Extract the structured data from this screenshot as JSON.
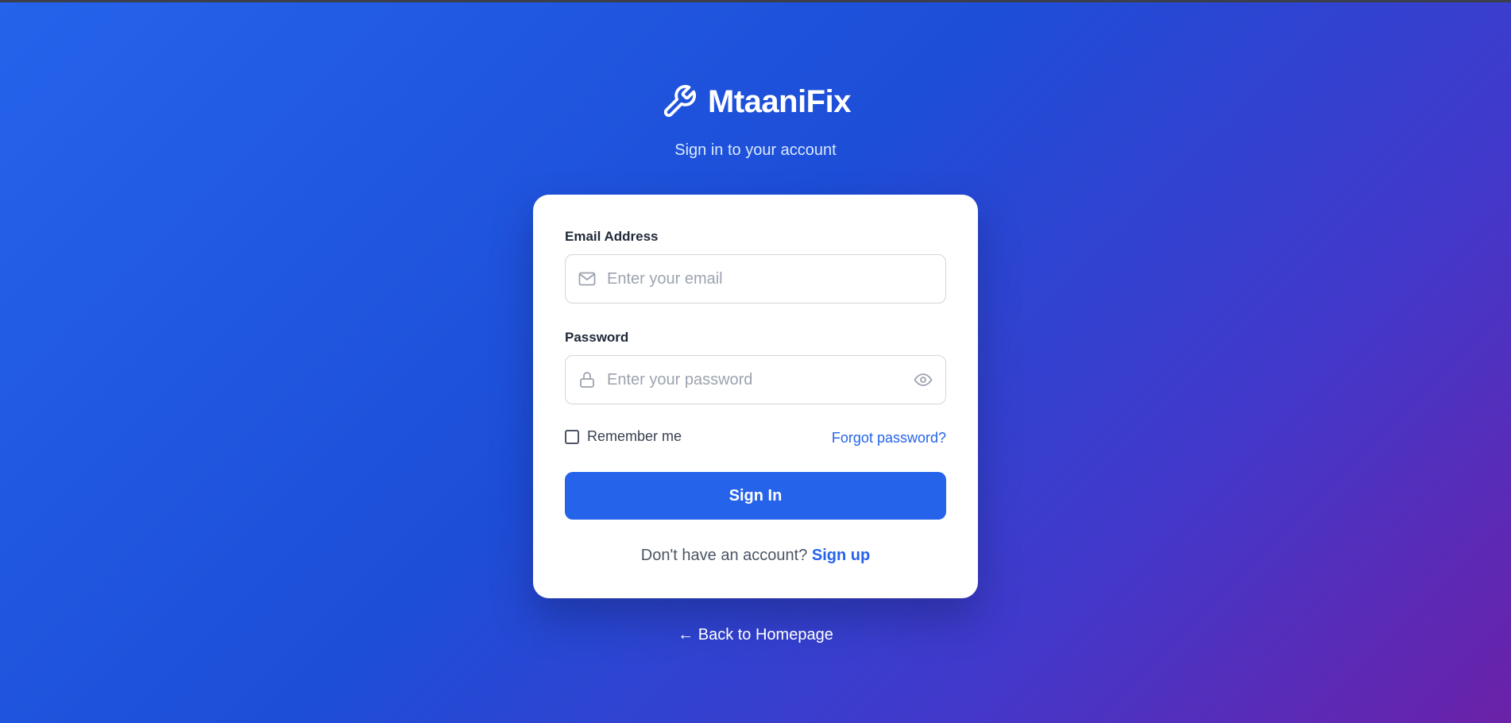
{
  "brand": {
    "name": "MtaaniFix",
    "icon": "wrench-icon"
  },
  "subtitle": "Sign in to your account",
  "form": {
    "email": {
      "label": "Email Address",
      "placeholder": "Enter your email",
      "value": "",
      "icon": "mail-icon"
    },
    "password": {
      "label": "Password",
      "placeholder": "Enter your password",
      "value": "",
      "icon": "lock-icon",
      "toggle_icon": "eye-icon"
    },
    "remember_label": "Remember me",
    "remember_checked": false,
    "forgot_label": "Forgot password?",
    "submit_label": "Sign In",
    "signup_prompt": "Don't have an account?",
    "signup_label": "Sign up"
  },
  "back_link": "← Back to Homepage",
  "colors": {
    "accent": "#2563eb",
    "gradient_start": "#2563eb",
    "gradient_end": "#6b21a8"
  }
}
